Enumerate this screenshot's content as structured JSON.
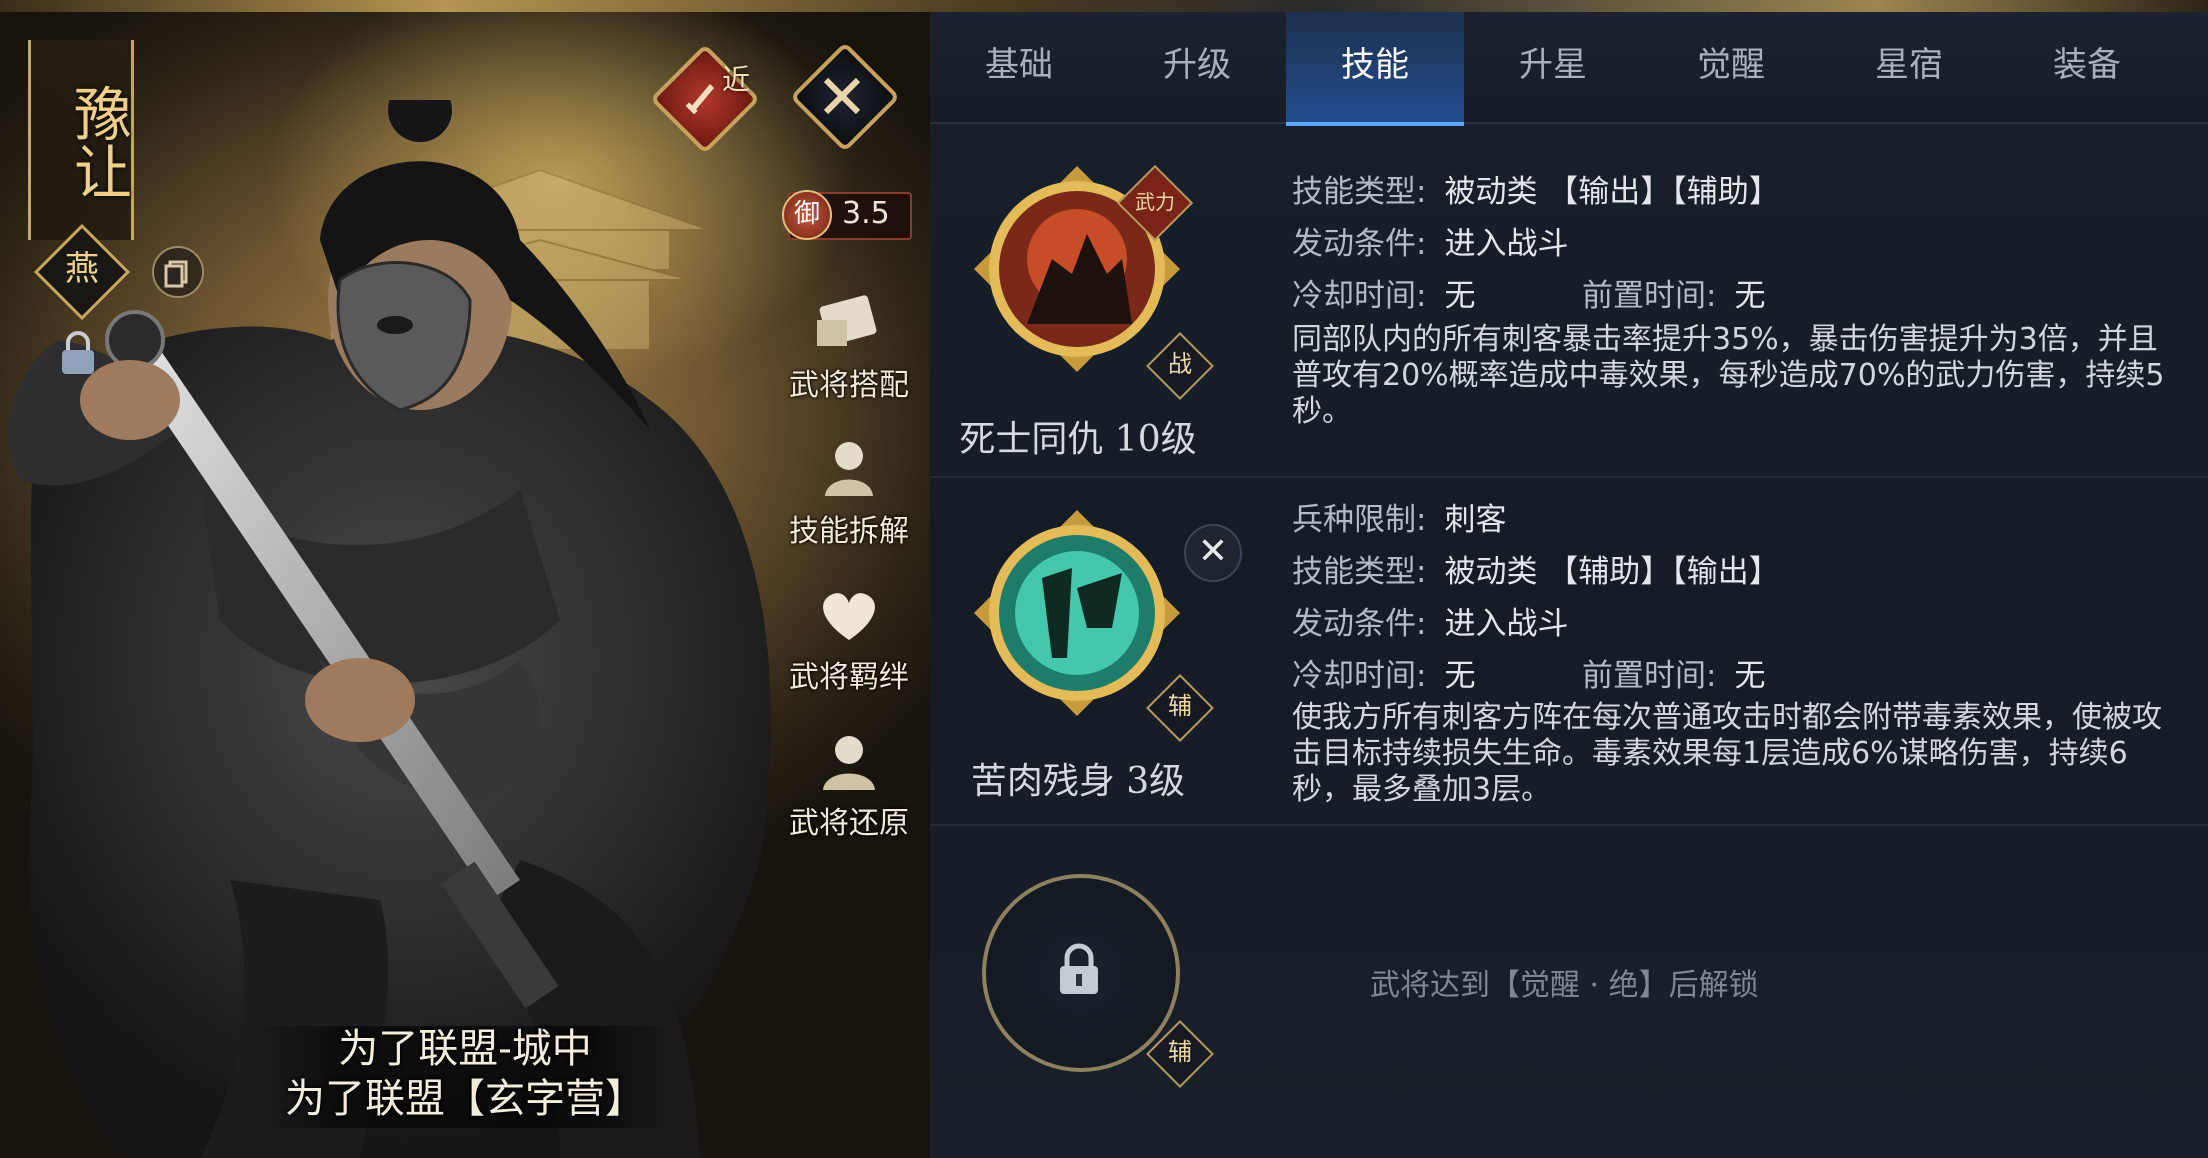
{
  "hero": {
    "name": "豫让",
    "faction": "燕",
    "range_tag": "近",
    "defense_label": "御",
    "defense_value": "3.5",
    "side_buttons": [
      "武将搭配",
      "技能拆解",
      "武将羁绊",
      "武将还原"
    ],
    "caption_line1": "为了联盟-城中",
    "caption_line2": "为了联盟【玄字营】"
  },
  "tabs": [
    "基础",
    "升级",
    "技能",
    "升星",
    "觉醒",
    "星宿",
    "装备"
  ],
  "active_tab": "技能",
  "skills": [
    {
      "name": "死士同仇 10级",
      "badge_top": "武力",
      "badge_bottom": "战",
      "type_key": "技能类型:",
      "type_val": "被动类 【输出】【辅助】",
      "trigger_key": "发动条件:",
      "trigger_val": "进入战斗",
      "cd_key": "冷却时间:",
      "cd_val": "无",
      "pre_key": "前置时间:",
      "pre_val": "无",
      "desc": "同部队内的所有刺客暴击率提升35%，暴击伤害提升为3倍，并且普攻有20%概率造成中毒效果，每秒造成70%的武力伤害，持续5秒。"
    },
    {
      "name": "苦肉残身 3级",
      "badge_bottom": "辅",
      "close": "✕",
      "limit_key": "兵种限制:",
      "limit_val": "刺客",
      "type_key": "技能类型:",
      "type_val": "被动类 【辅助】【输出】",
      "trigger_key": "发动条件:",
      "trigger_val": "进入战斗",
      "cd_key": "冷却时间:",
      "cd_val": "无",
      "pre_key": "前置时间:",
      "pre_val": "无",
      "desc": "使我方所有刺客方阵在每次普通攻击时都会附带毒素效果，使被攻击目标持续损失生命。毒素效果每1层造成6%谋略伤害，持续6秒，最多叠加3层。"
    }
  ],
  "locked_slot": {
    "badge_bottom": "辅",
    "unlock_text": "武将达到【觉醒 · 绝】后解锁"
  },
  "colors": {
    "active_tab": "#5fa6ff",
    "gold": "#c8a15c",
    "panel_bg": "#18202b"
  }
}
